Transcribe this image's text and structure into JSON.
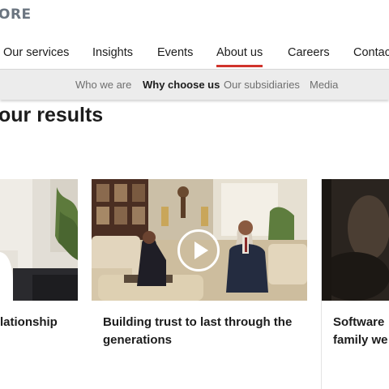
{
  "brand": {
    "logo_text": "ORE"
  },
  "main_nav": {
    "items": [
      "Our services",
      "Insights",
      "Events",
      "About us",
      "Careers",
      "Contac"
    ],
    "active": "About us",
    "accent_color": "#d0342c"
  },
  "sub_nav": {
    "items": [
      "Who we are",
      "Why choose us",
      "Our subsidiaries",
      "Media"
    ],
    "active": "Why choose us"
  },
  "section": {
    "heading": "our results"
  },
  "cards": [
    {
      "title": "lationship",
      "media_icon": ""
    },
    {
      "title": "Building trust to last through the generations",
      "media_icon": "play-icon"
    },
    {
      "title": "Software family we",
      "title_lines": [
        "Software",
        "family we"
      ],
      "media_icon": ""
    }
  ]
}
